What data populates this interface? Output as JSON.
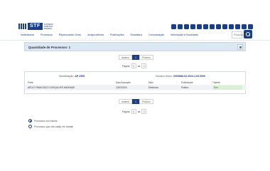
{
  "header": {
    "logo_text": "STF",
    "logo_subtitle": "SUPREMO TRIBUNAL FEDERAL",
    "social_icons": [
      "youtube-icon",
      "instagram-icon",
      "facebook-icon",
      "twitter-icon",
      "flickr-icon",
      "soundcloud-icon",
      "spotify-icon",
      "podcast-icon",
      "tiktok-icon",
      "linkedin-icon",
      "whatsapp-icon",
      "rss-icon",
      "email-icon"
    ],
    "nav": [
      "Institucional",
      "Processos",
      "Repercussão Geral",
      "Jurisprudência",
      "Publicações",
      "Estatística",
      "Comunicação",
      "Informação à Sociedade"
    ],
    "search_placeholder": "Pesquisa"
  },
  "results": {
    "title": "Quantidade de Processos: 1"
  },
  "pager": {
    "prev": "Anterior",
    "current": "1",
    "next": "Próximo",
    "page_label": "Página",
    "page_value": "1",
    "of_label": "de",
    "total_pages": "1"
  },
  "process": {
    "ident_label": "Identificação:",
    "ident_value": "AP 2559",
    "number_label": "Número Único:",
    "number_value": "0000886-02.2024.1.00.0000",
    "headers": {
      "parte": "Parte",
      "data": "Data Autuação",
      "meio": "Meio",
      "publicidade": "Publicidade",
      "trami": "Trâmite"
    },
    "row": {
      "parte": "AÉCIO FRANCISCO GONÇALVES ANDRADE",
      "data": "13/03/2024",
      "meio": "Eletrônico",
      "publicidade": "Público",
      "trami": "Sim"
    }
  },
  "filters": {
    "option1": "Processos em trâmite",
    "option2": "Processos que não estão em trâmite",
    "selected": "option1"
  },
  "colors": {
    "brand": "#1b3e8a",
    "result_bar": "#dbe7f3",
    "badge_bg": "#d8f0d4"
  }
}
